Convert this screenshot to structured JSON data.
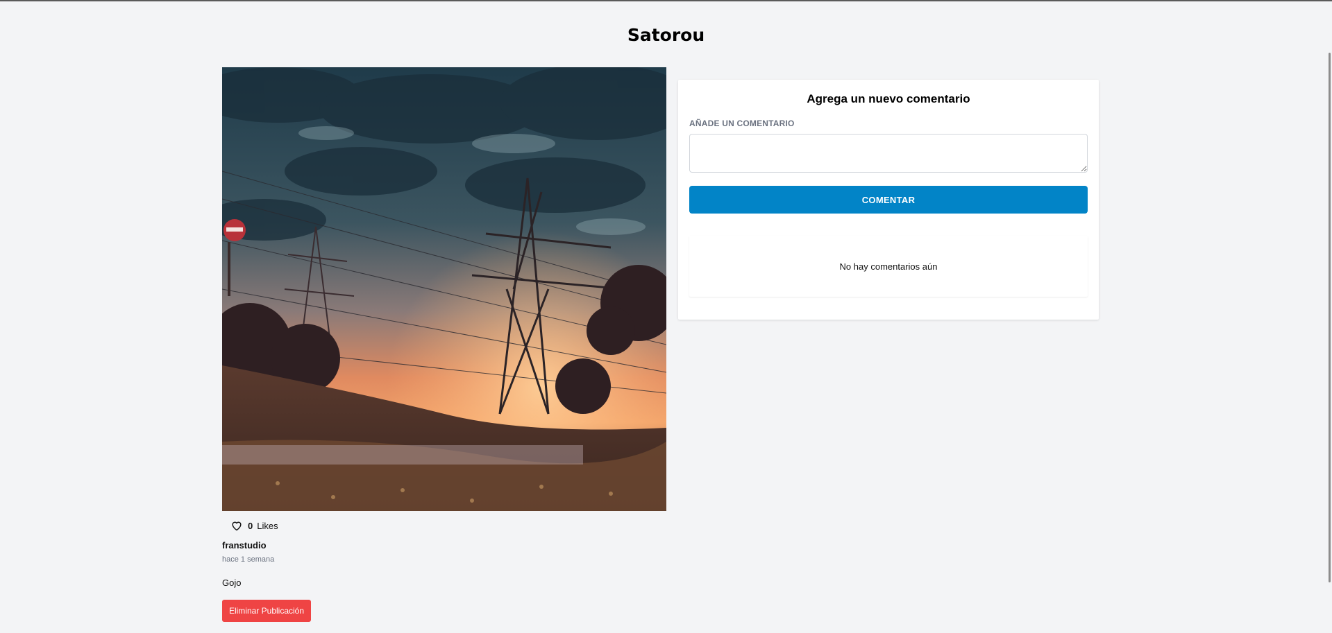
{
  "page": {
    "title": "Satorou"
  },
  "post": {
    "image_alt": "Ilustración de torres eléctricas al atardecer",
    "likes": {
      "count": "0",
      "label": "Likes",
      "icon": "heart-icon"
    },
    "author": "franstudio",
    "time_ago": "hace 1 semana",
    "description": "Gojo",
    "delete_label": "Eliminar Publicación"
  },
  "comment_form": {
    "heading": "Agrega un nuevo comentario",
    "field_label": "AÑADE UN COMENTARIO",
    "field_value": "",
    "submit_label": "COMENTAR"
  },
  "comments": {
    "empty_text": "No hay comentarios aún"
  },
  "colors": {
    "page_bg": "#f3f4f6",
    "primary": "#0284c7",
    "danger": "#ef4444",
    "muted_text": "#6b7280"
  }
}
